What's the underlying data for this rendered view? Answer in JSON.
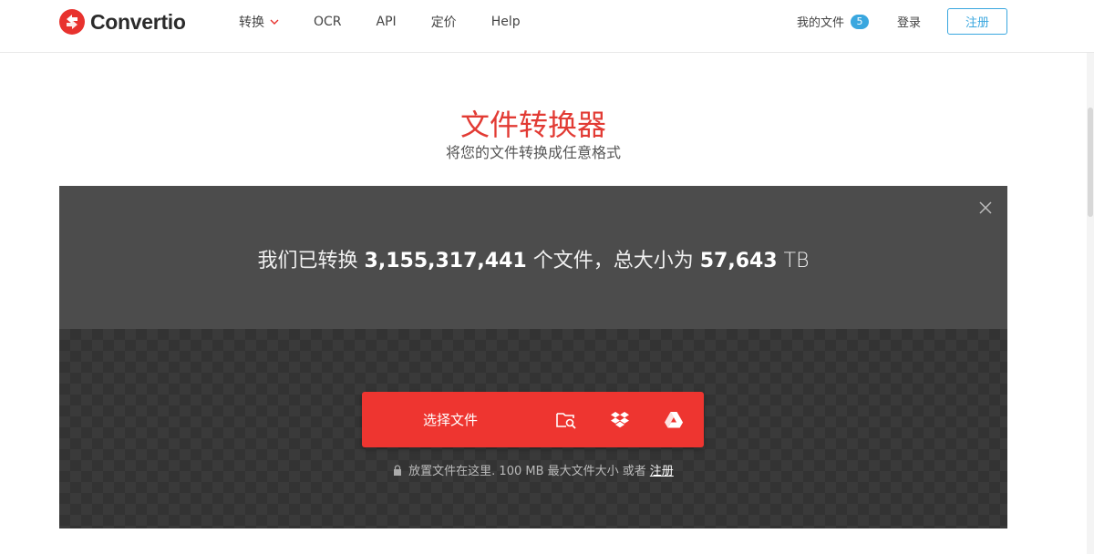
{
  "header": {
    "logo_text": "Convertio",
    "nav": [
      {
        "label": "转换",
        "has_dropdown": true
      },
      {
        "label": "OCR"
      },
      {
        "label": "API"
      },
      {
        "label": "定价"
      },
      {
        "label": "Help"
      }
    ],
    "my_files_label": "我的文件",
    "my_files_count": "5",
    "login_label": "登录",
    "signup_label": "注册"
  },
  "hero": {
    "title": "文件转换器",
    "subtitle": "将您的文件转换成任意格式"
  },
  "stats": {
    "prefix": "我们已转换",
    "files_count": "3,155,317,441",
    "middle": "个文件，总大小为",
    "total_size": "57,643",
    "unit": "TB"
  },
  "upload": {
    "choose_label": "选择文件",
    "hint_text": "放置文件在这里. 100 MB 最大文件大小 或者",
    "hint_link": "注册"
  },
  "colors": {
    "brand_red": "#ee3530",
    "title_red": "#e23b34",
    "accent_blue": "#3aa7df",
    "panel_dark": "#4c4c4c"
  },
  "icons": [
    "convertio-logo-icon",
    "chevron-down-icon",
    "close-icon",
    "folder-search-icon",
    "dropbox-icon",
    "google-drive-icon",
    "lock-icon"
  ]
}
